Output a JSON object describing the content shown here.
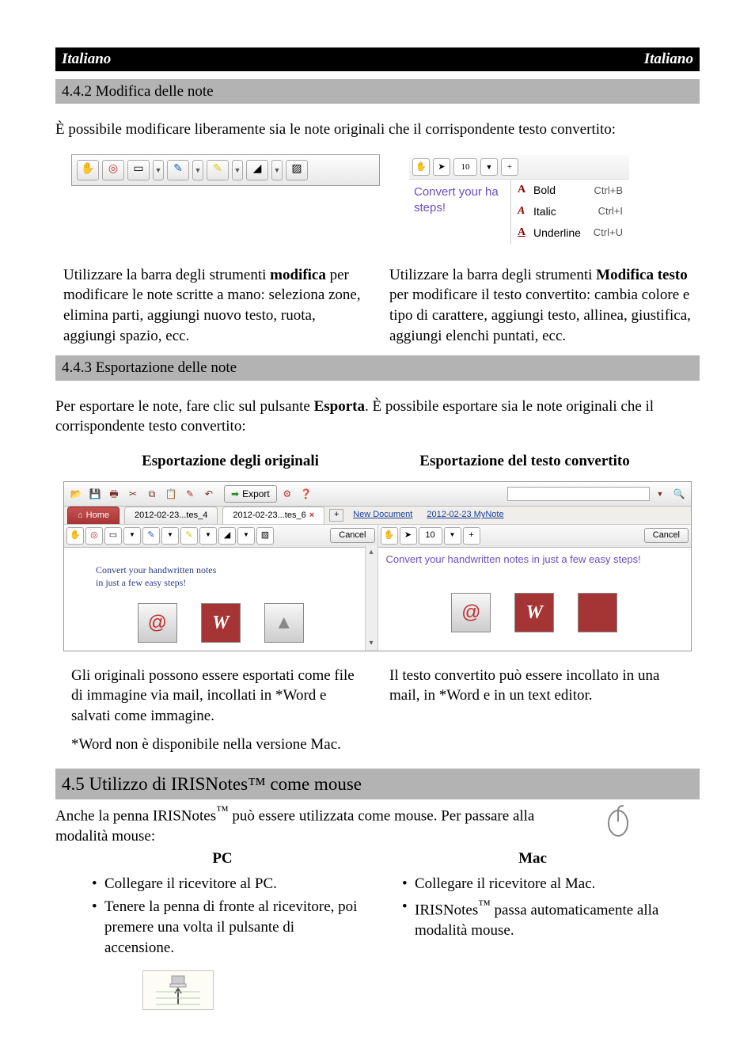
{
  "header": {
    "left": "Italiano",
    "right": "Italiano"
  },
  "sec442": {
    "title": "4.4.2 Modifica delle note"
  },
  "p1": "È possibile modificare liberamente sia le note originali che il corrispondente testo convertito:",
  "ctx": {
    "size": "10",
    "sample_a": "Convert your ha",
    "sample_b": "steps!",
    "menu": {
      "bold": {
        "label": "Bold",
        "sc": "Ctrl+B"
      },
      "italic": {
        "label": "Italic",
        "sc": "Ctrl+I"
      },
      "underline": {
        "label": "Underline",
        "sc": "Ctrl+U"
      }
    }
  },
  "desc_left": {
    "prefix": "Utilizzare la barra degli strumenti ",
    "bold": "modifica",
    "rest": " per modificare le note scritte a mano: seleziona zone, elimina parti, aggiungi nuovo testo, ruota, aggiungi spazio, ecc."
  },
  "desc_right": {
    "prefix": "Utilizzare la barra degli strumenti ",
    "bold": "Modifica testo",
    "rest": " per modificare il testo convertito: cambia colore e tipo di carattere, aggiungi testo, allinea, giustifica, aggiungi elenchi puntati, ecc."
  },
  "sec443": {
    "title": "4.4.3 Esportazione delle note"
  },
  "p2a": "Per esportare le note, fare clic sul pulsante ",
  "p2b": "Esporta",
  "p2c": ". È possibile esportare sia le note originali che il corrispondente testo convertito:",
  "export_labels": {
    "left": "Esportazione degli originali",
    "right": "Esportazione del testo convertito"
  },
  "export_ui": {
    "export_btn": "Export",
    "home": "Home",
    "tab1": "2012-02-23...tes_4",
    "tab2": "2012-02-23...tes_6",
    "newdoc": "New Document",
    "mynote": "2012-02-23 MyNote",
    "cancel": "Cancel",
    "hand_line1": "Convert your handwritten notes",
    "hand_line2": "in just a few easy steps!",
    "converted": "Convert your handwritten notes in just a few easy steps!",
    "search_placeholder": ""
  },
  "exp_desc_left": "Gli originali possono essere esportati come file di immagine via mail, incollati in *Word e salvati come immagine.",
  "exp_desc_right": "Il testo convertito può essere incollato in una mail, in *Word e in un text editor.",
  "footnote": "*Word non è disponibile nella versione Mac.",
  "sec45": {
    "title": "4.5 Utilizzo di IRISNotes™ come mouse"
  },
  "p3a": "Anche la penna IRISNotes",
  "p3tm": "™",
  "p3b": " può essere utilizzata come mouse. Per passare alla modalità mouse:",
  "pc": {
    "title": "PC",
    "b1": "Collegare il ricevitore al PC.",
    "b2": "Tenere la penna di fronte al ricevitore, poi premere una volta il pulsante di accensione."
  },
  "mac": {
    "title": "Mac",
    "b1": "Collegare il ricevitore al Mac.",
    "b2a": "IRISNotes",
    "b2tm": "™",
    "b2b": " passa automaticamente alla modalità mouse."
  }
}
